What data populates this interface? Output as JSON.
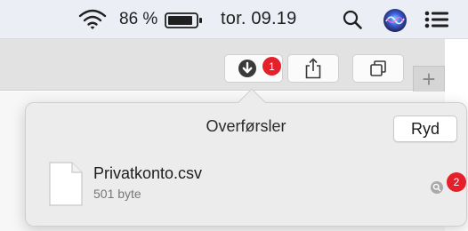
{
  "menubar": {
    "wifi_icon": "wifi-icon",
    "battery_percent": "86 %",
    "battery_icon": "battery-icon",
    "clock": "tor. 09.19",
    "search_icon": "magnifier-icon",
    "siri_icon": "siri-icon",
    "notifications_icon": "list-icon"
  },
  "toolbar": {
    "downloads_icon": "download-arrow-icon",
    "downloads_badge": "1",
    "share_icon": "share-icon",
    "tabs_icon": "tabs-overview-icon",
    "new_tab_label": "+"
  },
  "downloads": {
    "title": "Overførsler",
    "clear_label": "Ryd",
    "items": [
      {
        "name": "Privatkonto.csv",
        "size": "501 byte",
        "icon": "document-icon",
        "reveal_icon": "magnifier-icon",
        "reveal_badge": "2"
      }
    ]
  },
  "colors": {
    "badge_red": "#e6202b",
    "menubar_bg": "#eceef6",
    "toolbar_bg": "#e3e2e3",
    "popover_bg": "#ececec"
  }
}
